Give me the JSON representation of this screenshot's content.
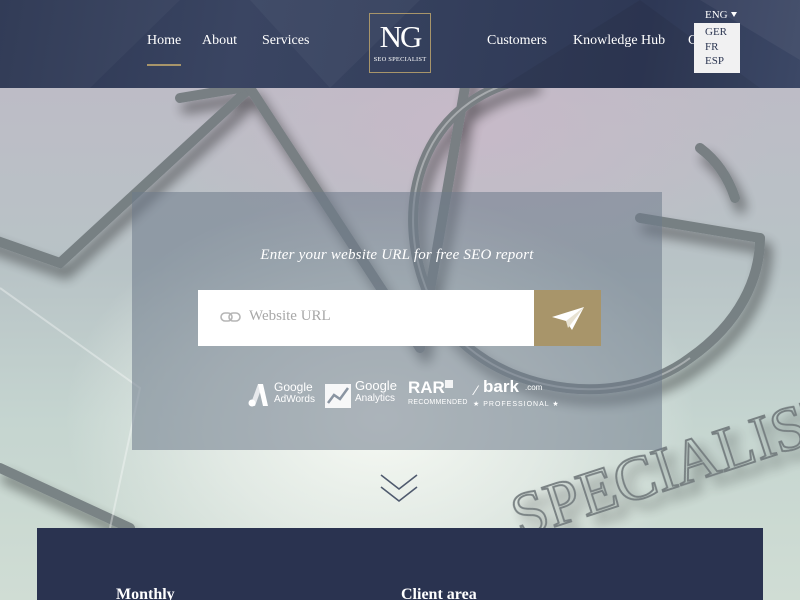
{
  "nav": {
    "left": [
      "Home",
      "About",
      "Services"
    ],
    "right": [
      "Customers",
      "Knowledge Hub",
      "C"
    ]
  },
  "logo": {
    "mark": "NG",
    "subtitle": "SEO SPECIALIST"
  },
  "language": {
    "current": "ENG",
    "options": [
      "GER",
      "FR",
      "ESP"
    ]
  },
  "hero": {
    "heading": "Enter your website URL for free SEO report",
    "url_placeholder": "Website URL",
    "background_word": "NG SPECIALIST"
  },
  "badges": [
    {
      "name": "Google",
      "sub": "AdWords"
    },
    {
      "name": "Google",
      "sub": "Analytics"
    },
    {
      "name": "RAR",
      "sub": "RECOMMENDED"
    },
    {
      "name": "bark",
      "suffix": ".com",
      "sub": "★ PROFESSIONAL ★"
    }
  ],
  "footer_band": {
    "col1": "Monthly",
    "col2": "Client area"
  },
  "colors": {
    "navy": "#2c3652",
    "gold": "#a8956a",
    "panel": "#6e7a8a"
  }
}
